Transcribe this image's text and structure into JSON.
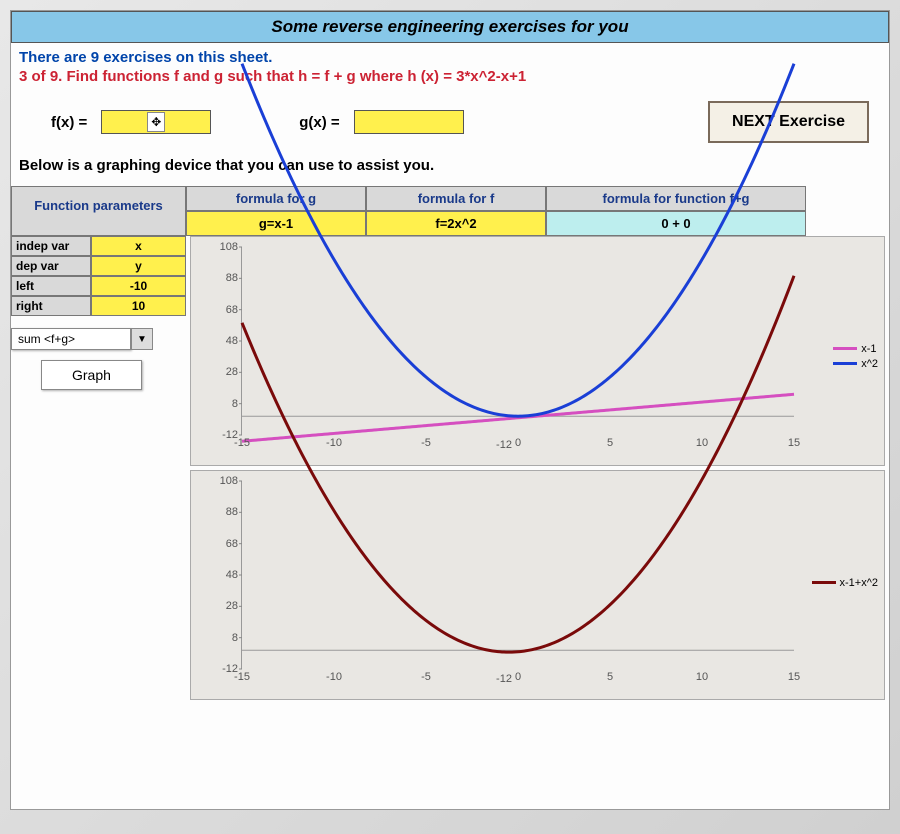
{
  "title": "Some reverse engineering exercises for you",
  "intro_line1": "There are 9 exercises on this sheet.",
  "intro_line2": "3 of 9. Find functions f and g such that h = f + g where h (x) = 3*x^2-x+1",
  "fx_label": "f(x) =",
  "gx_label": "g(x) =",
  "cursor_glyph": "✥",
  "next_label": "NEXT Exercise",
  "assist_line": "Below is a graphing device that you can use to assist you.",
  "headers": {
    "params": "Function parameters",
    "g": "formula for g",
    "f": "formula for f",
    "sum": "formula for function  f+g"
  },
  "formulas": {
    "g": "g=x-1",
    "f": "f=2x^2",
    "sum": "0 + 0"
  },
  "params": [
    {
      "k": "indep var",
      "v": "x"
    },
    {
      "k": "dep var",
      "v": "y"
    },
    {
      "k": "left",
      "v": "-10"
    },
    {
      "k": "right",
      "v": "10"
    }
  ],
  "selector_value": "sum <f+g>",
  "graph_label": "Graph",
  "chart_data": [
    {
      "type": "line",
      "xlim": [
        -15,
        15
      ],
      "ylim": [
        -12,
        108
      ],
      "xticks": [
        -15,
        -10,
        -5,
        0,
        5,
        10,
        15
      ],
      "yticks": [
        -12,
        8,
        28,
        48,
        68,
        88,
        108
      ],
      "x_extra_label": "-12",
      "series": [
        {
          "name": "x-1",
          "color": "#d54fc0",
          "formula": "x-1"
        },
        {
          "name": "x^2",
          "color": "#1a3fd6",
          "formula": "x*x"
        }
      ]
    },
    {
      "type": "line",
      "xlim": [
        -15,
        15
      ],
      "ylim": [
        -12,
        108
      ],
      "xticks": [
        -15,
        -10,
        -5,
        0,
        5,
        10,
        15
      ],
      "yticks": [
        -12,
        8,
        28,
        48,
        68,
        88,
        108
      ],
      "x_extra_label": "-12",
      "series": [
        {
          "name": "x-1+x^2",
          "color": "#7a0a0a",
          "formula": "x*x+x-1"
        }
      ]
    }
  ]
}
